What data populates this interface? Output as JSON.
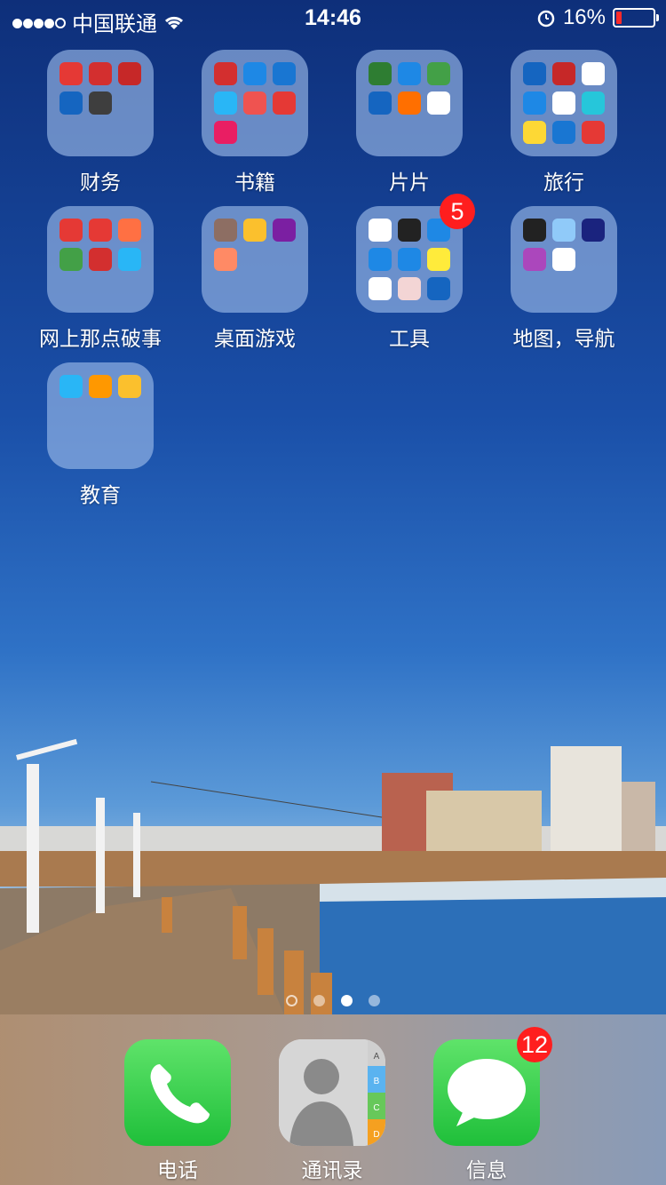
{
  "status": {
    "carrier": "中国联通",
    "time": "14:46",
    "battery": "16%",
    "battery_fraction": 0.16
  },
  "apps": [
    {
      "label": "财务",
      "minis": [
        "#e53935",
        "#d32f2f",
        "#c62828",
        "#1565c0",
        "#3e3e3e"
      ],
      "badge": ""
    },
    {
      "label": "书籍",
      "minis": [
        "#d32f2f",
        "#1e88e5",
        "#1976d2",
        "#29b6f6",
        "#ef5350",
        "#e53935",
        "#e91e63"
      ],
      "badge": ""
    },
    {
      "label": "片片",
      "minis": [
        "#2e7d32",
        "#1e88e5",
        "#43a047",
        "#1565c0",
        "#ff6f00",
        "#ffffff"
      ],
      "badge": ""
    },
    {
      "label": "旅行",
      "minis": [
        "#1565c0",
        "#c62828",
        "#ffffff",
        "#1e88e5",
        "#ffffff",
        "#26c6da",
        "#fdd835",
        "#1976d2",
        "#e53935"
      ],
      "badge": ""
    },
    {
      "label": "网上那点破事",
      "minis": [
        "#e53935",
        "#e53935",
        "#ff7043",
        "#43a047",
        "#d32f2f",
        "#29b6f6"
      ],
      "badge": ""
    },
    {
      "label": "桌面游戏",
      "minis": [
        "#8d6e63",
        "#fbc02d",
        "#7b1fa2",
        "#ff8a65"
      ],
      "badge": ""
    },
    {
      "label": "工具",
      "minis": [
        "#ffffff",
        "#222222",
        "#1e88e5",
        "#1e88e5",
        "#1e88e5",
        "#ffeb3b",
        "#ffffff",
        "#f3d5d5",
        "#1565c0"
      ],
      "badge": "5"
    },
    {
      "label": "地图，导航",
      "minis": [
        "#222222",
        "#90caf9",
        "#1a237e",
        "#ab47bc",
        "#ffffff"
      ],
      "badge": ""
    },
    {
      "label": "教育",
      "minis": [
        "#29b6f6",
        "#ff9800",
        "#fbc02d"
      ],
      "badge": ""
    }
  ],
  "dock": [
    {
      "label": "电话",
      "badge": ""
    },
    {
      "label": "通讯录",
      "badge": "",
      "index_letters": [
        "A",
        "B",
        "C",
        "D"
      ]
    },
    {
      "label": "信息",
      "badge": "12"
    }
  ],
  "pages": {
    "count": 3,
    "current": 2
  }
}
